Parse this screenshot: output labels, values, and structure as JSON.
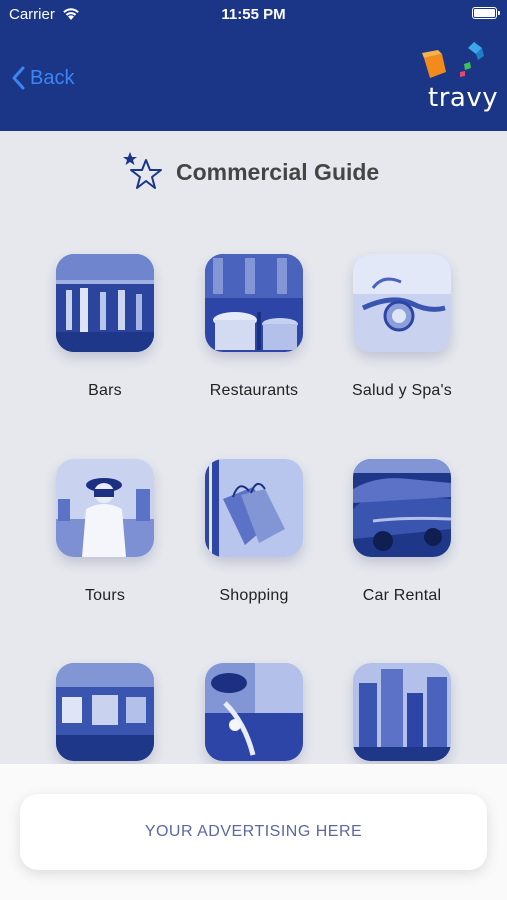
{
  "status_bar": {
    "carrier": "Carrier",
    "time": "11:55 PM"
  },
  "nav": {
    "back_label": "Back"
  },
  "logo": {
    "wordmark": "travy"
  },
  "page": {
    "title": "Commercial Guide"
  },
  "categories": [
    {
      "label": "Bars",
      "icon": "bars-photo"
    },
    {
      "label": "Restaurants",
      "icon": "restaurants-photo"
    },
    {
      "label": "Salud y Spa's",
      "icon": "stethoscope-photo"
    },
    {
      "label": "Tours",
      "icon": "tourist-photo"
    },
    {
      "label": "Shopping",
      "icon": "shopping-bags-photo"
    },
    {
      "label": "Car Rental",
      "icon": "cars-photo"
    },
    {
      "label": "",
      "icon": "museum-photo"
    },
    {
      "label": "",
      "icon": "golf-photo"
    },
    {
      "label": "",
      "icon": "city-buildings-photo"
    }
  ],
  "ad": {
    "text": "YOUR ADVERTISING HERE"
  },
  "colors": {
    "header": "#1b3687",
    "back": "#3b86f5",
    "background": "#e6e8ee",
    "tint": "#2c45a6"
  }
}
